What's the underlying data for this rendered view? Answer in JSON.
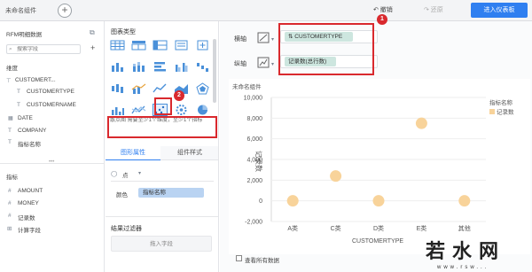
{
  "topbar": {
    "tab_title": "未命名组件",
    "add_label": "+",
    "undo_label": "↶ 撤销",
    "redo_label": "↷ 还原",
    "enter_dashboard": "进入仪表板"
  },
  "data_panel": {
    "dataset_name": "RFM明细数据",
    "search_placeholder": "搜索字段",
    "add_label": "+",
    "dimension_title": "维度",
    "dimension_items": [
      {
        "icon": "T",
        "label": "CUSTOMERT..."
      },
      {
        "icon": "T",
        "label": "CUSTOMERTYPE"
      },
      {
        "icon": "T",
        "label": "CUSTOMERNAME"
      },
      {
        "icon": "📅",
        "label": "DATE"
      },
      {
        "icon": "T",
        "label": "COMPANY"
      },
      {
        "icon": "T",
        "label": "指标名称"
      }
    ],
    "measure_title": "指标",
    "measure_items": [
      {
        "icon": "#",
        "label": "AMOUNT"
      },
      {
        "icon": "#",
        "label": "MONEY"
      },
      {
        "icon": "#",
        "label": "记录数"
      },
      {
        "icon": "⊞",
        "label": "计算字段"
      }
    ]
  },
  "chart_type_panel": {
    "title": "图表类型",
    "description": "散点图 需要至少1个维度，至少1个指标",
    "tabs": [
      "图形属性",
      "组件样式"
    ],
    "point_select": "点",
    "color_label": "颜色",
    "color_field": "指标名称",
    "result_filter": "结果过滤器",
    "drop_field": "拖入字段"
  },
  "axes": {
    "x_label": "横轴",
    "x_field": "CUSTOMERTYPE",
    "y_label": "纵轴",
    "y_field": "记录数(总行数)"
  },
  "chart_component_title": "未命名组件",
  "show_all_data": "查看所有数据",
  "annotations": {
    "badge1": "1",
    "badge2": "2"
  },
  "watermark": {
    "main": "若水网",
    "sub": "www.rsw..."
  },
  "chart_data": {
    "type": "scatter",
    "title": "",
    "xlabel": "CUSTOMERTYPE",
    "ylabel": "记录数",
    "categories": [
      "A类",
      "C类",
      "D类",
      "E类",
      "其他"
    ],
    "yticks": [
      "10,000",
      "8,000",
      "6,000",
      "4,000",
      "2,000",
      "0",
      "-2,000"
    ],
    "ylim": [
      -2000,
      10000
    ],
    "legend_title": "指标名称",
    "series": [
      {
        "name": "记录数",
        "color": "#f8d39a",
        "values": [
          0,
          2400,
          0,
          7500,
          0
        ]
      }
    ]
  },
  "colors": {
    "accent": "#2f7ff0",
    "annotation": "#d9292e",
    "dimension_pill": "#cde6df",
    "color_pill": "#b9d3f2",
    "point": "#f8d39a"
  }
}
